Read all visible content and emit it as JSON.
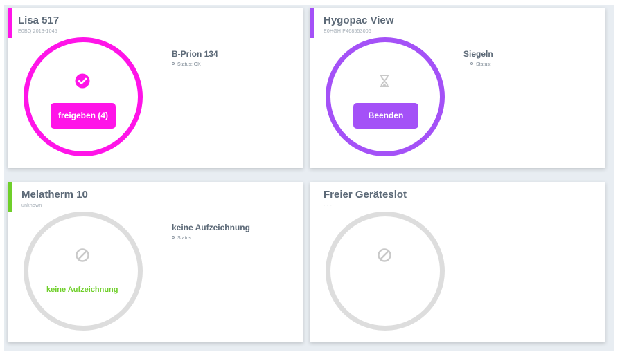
{
  "colors": {
    "magenta": "#ff14e8",
    "purple": "#a451f7",
    "green": "#6fcf2a",
    "gray": "#dddddd"
  },
  "cards": [
    {
      "title": "Lisa 517",
      "subtitle": "E0BQ 2013-1045",
      "accent": "#ff14e8",
      "ring_icon": "check-circle-icon",
      "button_label": "freigeben (4)",
      "device_name": "B-Prion 134",
      "status": "Status: OK"
    },
    {
      "title": "Hygopac View",
      "subtitle": "E0HGH P468553006",
      "accent": "#a451f7",
      "ring_icon": "hourglass-icon",
      "button_label": "Beenden",
      "device_name": "Siegeln",
      "status": "Status:"
    },
    {
      "title": "Melatherm 10",
      "subtitle": "unknown",
      "accent": "#6fcf2a",
      "ring_icon": "prohibited-icon",
      "ring_label": "keine Aufzeichnung",
      "device_name": "keine Aufzeichnung",
      "status": "Status:"
    },
    {
      "title": "Freier Geräteslot",
      "subtitle": "- - -",
      "ring_icon": "prohibited-icon"
    }
  ]
}
